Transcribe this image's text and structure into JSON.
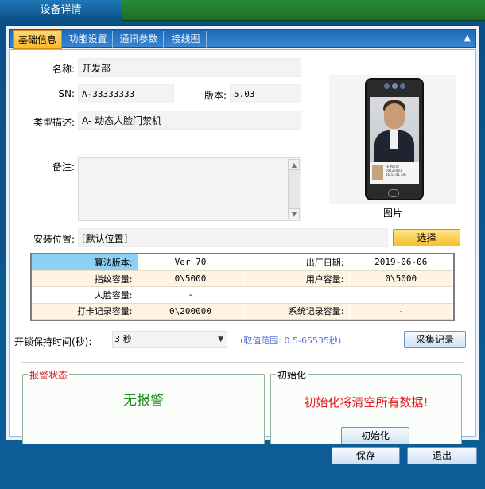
{
  "window": {
    "title": "设备详情"
  },
  "tabs": [
    {
      "label": "基础信息",
      "active": true
    },
    {
      "label": "功能设置",
      "active": false
    },
    {
      "label": "通讯参数",
      "active": false
    },
    {
      "label": "接线图",
      "active": false
    }
  ],
  "form": {
    "name": {
      "label": "名称:",
      "value": "开发部"
    },
    "sn": {
      "label": "SN:",
      "value": "A-33333333"
    },
    "version": {
      "label": "版本:",
      "value": "5.03"
    },
    "type_desc": {
      "label": "类型描述:",
      "value": "A- 动态人脸门禁机"
    },
    "remark": {
      "label": "备注:",
      "value": ""
    },
    "install_location": {
      "label": "安装位置:",
      "value": "[默认位置]"
    },
    "select_button": "选择"
  },
  "photo": {
    "caption": "图片",
    "screen_greeting": "Hi Mark!",
    "screen_id": "00125481",
    "screen_time": "16:53:41 am"
  },
  "info_table": {
    "rows": [
      [
        "算法版本:",
        "Ver 70",
        "出厂日期:",
        "2019-06-06"
      ],
      [
        "指纹容量:",
        "0\\5000",
        "用户容量:",
        "0\\5000"
      ],
      [
        "人脸容量:",
        "-",
        "",
        ""
      ],
      [
        "打卡记录容量:",
        "0\\200000",
        "系统记录容量:",
        "-"
      ]
    ]
  },
  "unlock": {
    "label": "开锁保持时间(秒):",
    "value": "3 秒",
    "range": "(取值范围: 0.5-65535秒)",
    "collect_button": "采集记录"
  },
  "alarm_group": {
    "title": "报警状态",
    "status": "无报警",
    "title_color": "#d42020",
    "status_color": "#1f8f1f"
  },
  "init_group": {
    "title": "初始化",
    "warning": "初始化将清空所有数据!",
    "button": "初始化"
  },
  "footer": {
    "save": "保存",
    "exit": "退出"
  }
}
